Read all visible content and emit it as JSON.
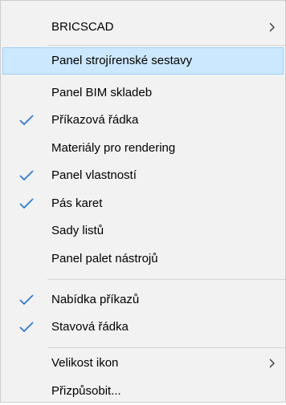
{
  "menu": {
    "items": [
      {
        "label": "BRICSCAD",
        "checked": false,
        "submenu": true,
        "highlighted": false
      },
      {
        "label": "Panel strojírenské sestavy",
        "checked": false,
        "submenu": false,
        "highlighted": true
      },
      {
        "label": "Panel BIM skladeb",
        "checked": false,
        "submenu": false,
        "highlighted": false
      },
      {
        "label": "Příkazová řádka",
        "checked": true,
        "submenu": false,
        "highlighted": false
      },
      {
        "label": "Materiály pro rendering",
        "checked": false,
        "submenu": false,
        "highlighted": false
      },
      {
        "label": "Panel vlastností",
        "checked": true,
        "submenu": false,
        "highlighted": false
      },
      {
        "label": "Pás karet",
        "checked": true,
        "submenu": false,
        "highlighted": false
      },
      {
        "label": "Sady listů",
        "checked": false,
        "submenu": false,
        "highlighted": false
      },
      {
        "label": "Panel palet nástrojů",
        "checked": false,
        "submenu": false,
        "highlighted": false
      },
      {
        "label": "Nabídka příkazů",
        "checked": true,
        "submenu": false,
        "highlighted": false
      },
      {
        "label": "Stavová řádka",
        "checked": true,
        "submenu": false,
        "highlighted": false
      },
      {
        "label": "Velikost ikon",
        "checked": false,
        "submenu": true,
        "highlighted": false
      },
      {
        "label": "Přizpůsobit...",
        "checked": false,
        "submenu": false,
        "highlighted": false
      }
    ]
  },
  "colors": {
    "menu_background": "#f2f2f2",
    "highlight_background": "#cce8ff",
    "highlight_border": "#99d1ff",
    "checkmark": "#2b7bd3",
    "separator": "#d6d6d6"
  },
  "icons": {
    "check": "checkmark-icon",
    "submenu": "chevron-right-icon"
  }
}
